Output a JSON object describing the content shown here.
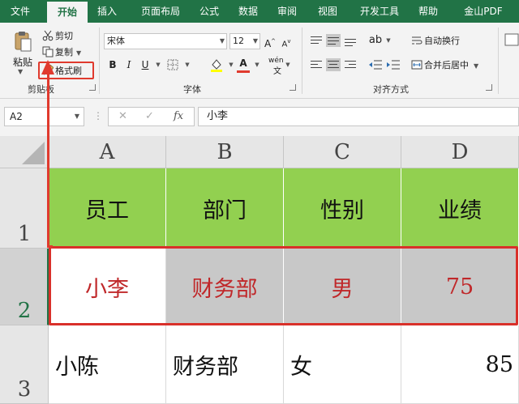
{
  "tabs": [
    {
      "label": "文件",
      "active": false
    },
    {
      "label": "开始",
      "active": true
    },
    {
      "label": "插入",
      "active": false
    },
    {
      "label": "页面布局",
      "active": false
    },
    {
      "label": "公式",
      "active": false
    },
    {
      "label": "数据",
      "active": false
    },
    {
      "label": "审阅",
      "active": false
    },
    {
      "label": "视图",
      "active": false
    },
    {
      "label": "开发工具",
      "active": false
    },
    {
      "label": "帮助",
      "active": false
    },
    {
      "label": "金山PDF",
      "active": false
    }
  ],
  "ribbon": {
    "clipboard": {
      "paste_label": "粘贴",
      "cut_label": "剪切",
      "copy_label": "复制",
      "format_painter_label": "格式刷",
      "group_label": "剪贴板"
    },
    "font": {
      "font_name": "宋体",
      "font_size": "12",
      "phonetic_label": "wén",
      "group_label": "字体"
    },
    "alignment": {
      "wrap_text_label": "自动换行",
      "merge_center_label": "合并后居中",
      "group_label": "对齐方式"
    }
  },
  "formula_bar": {
    "name_box": "A2",
    "fx_label": "fx",
    "content": "小李"
  },
  "sheet": {
    "columns": [
      "A",
      "B",
      "C",
      "D"
    ],
    "rows": [
      {
        "number": "1",
        "cells": [
          "员工",
          "部门",
          "性别",
          "业绩"
        ]
      },
      {
        "number": "2",
        "cells": [
          "小李",
          "财务部",
          "男",
          "75"
        ]
      },
      {
        "number": "3",
        "cells": [
          "小陈",
          "财务部",
          "女",
          "85"
        ]
      }
    ]
  },
  "colors": {
    "ribbon_green": "#217346",
    "header_fill": "#92d050",
    "highlight_red": "#e03a2e",
    "copied_text_red": "#c0282a",
    "gray_fill": "#c8c8c8"
  }
}
